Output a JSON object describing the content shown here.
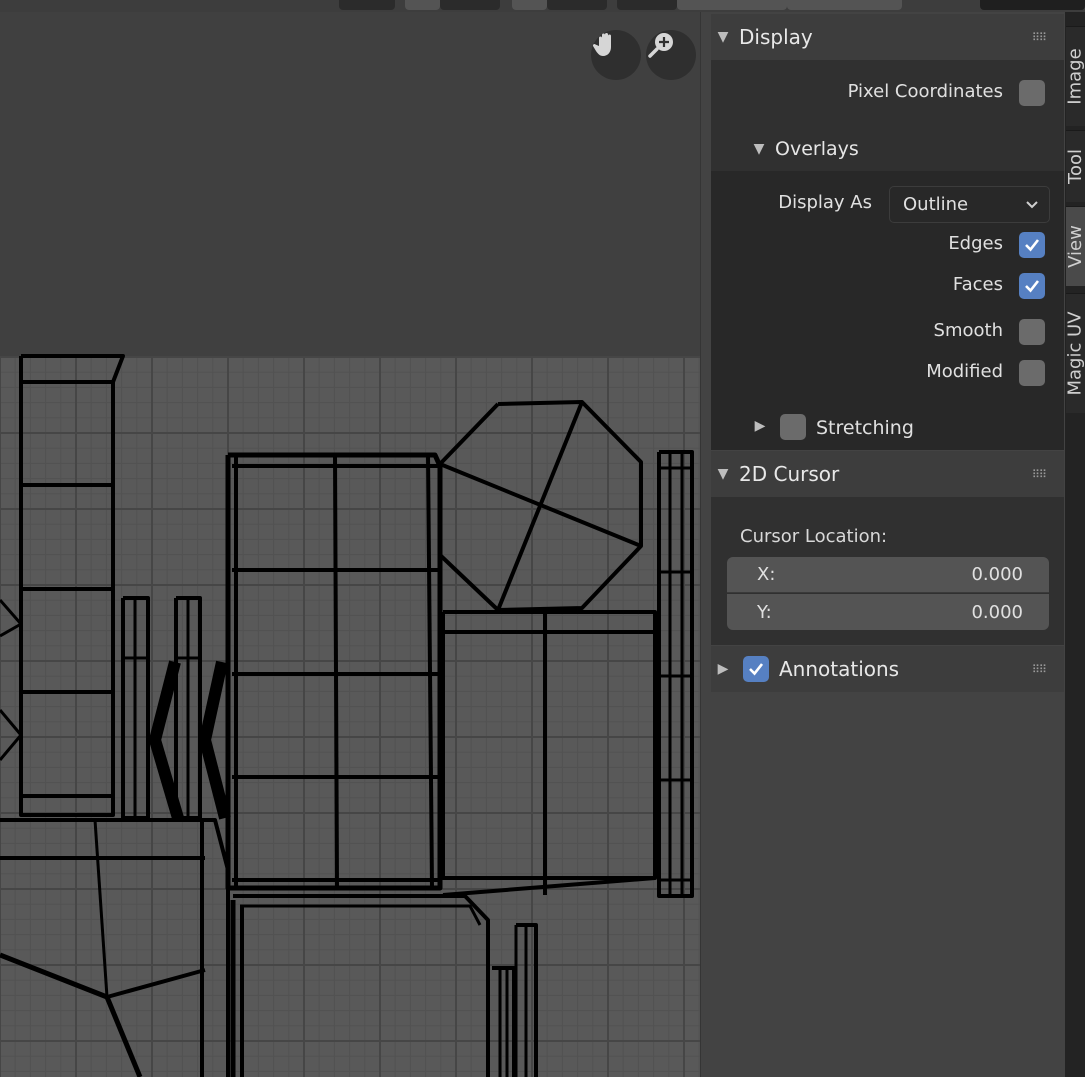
{
  "header": {
    "description": "Partial top header toolbar (cropped)"
  },
  "viewport": {
    "background": "#404040",
    "grid_color": "#4d4d4d",
    "image_bg": "#595959",
    "wire_color": "#000000",
    "gizmos": [
      {
        "name": "pan-hand-icon",
        "label": "Pan"
      },
      {
        "name": "zoom-magnifier-icon",
        "label": "Zoom"
      }
    ]
  },
  "sidebar": {
    "display_panel": {
      "title": "Display",
      "expanded": true,
      "pixel_coordinates": {
        "label": "Pixel Coordinates",
        "checked": false
      },
      "overlays": {
        "title": "Overlays",
        "expanded": true,
        "display_as": {
          "label": "Display As",
          "value": "Outline"
        },
        "edges": {
          "label": "Edges",
          "checked": true
        },
        "faces": {
          "label": "Faces",
          "checked": true
        },
        "smooth": {
          "label": "Smooth",
          "checked": false
        },
        "modified": {
          "label": "Modified",
          "checked": false
        }
      },
      "stretching": {
        "label": "Stretching",
        "checked": false,
        "expanded": false
      }
    },
    "cursor_panel": {
      "title": "2D Cursor",
      "expanded": true,
      "location_label": "Cursor Location:",
      "x": {
        "label": "X:",
        "value": "0.000"
      },
      "y": {
        "label": "Y:",
        "value": "0.000"
      }
    },
    "annotations_panel": {
      "title": "Annotations",
      "checked": true,
      "expanded": false
    }
  },
  "tabs": [
    {
      "label": "Image",
      "active": false
    },
    {
      "label": "Tool",
      "active": false
    },
    {
      "label": "View",
      "active": true
    },
    {
      "label": "Magic UV",
      "active": false
    }
  ],
  "colors": {
    "accent": "#5680c2",
    "checkbox_off": "#6b6b6b"
  }
}
